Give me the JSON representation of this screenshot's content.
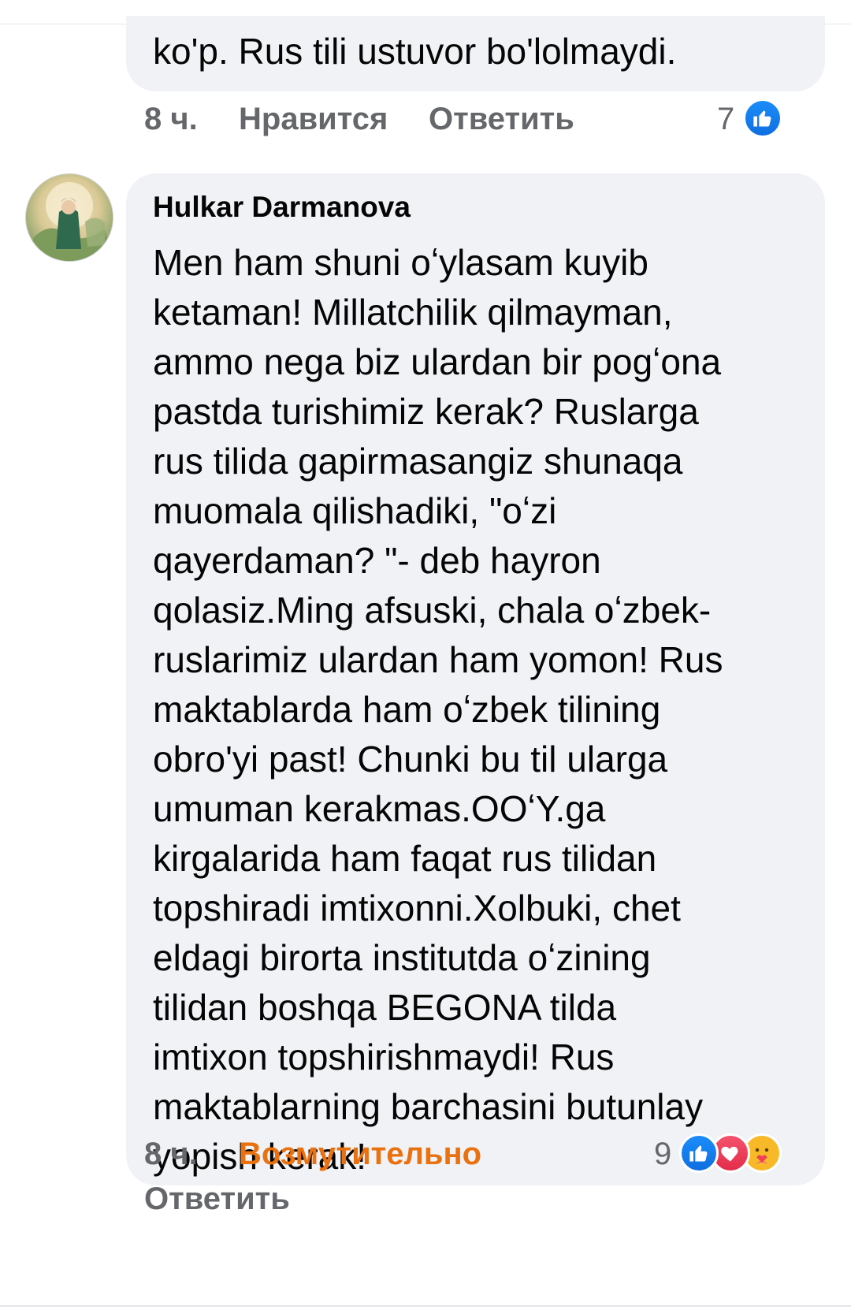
{
  "comment1": {
    "text_tail": "ko'p. Rus tili ustuvor bo'lolmaydi.",
    "time": "8 ч.",
    "like_label": "Нравится",
    "reply_label": "Ответить",
    "reaction_count": "7",
    "reaction_icons": [
      "like-icon"
    ]
  },
  "comment2": {
    "author": "Hulkar Darmanova",
    "lines": [
      "Men ham shuni oʻylasam kuyib",
      "ketaman!  Millatchilik qilmayman,",
      "ammo nega biz ulardan bir pogʻona",
      "pastda turishimiz kerak? Ruslarga",
      "rus tilida gapirmasangiz shunaqa",
      "muomala qilishadiki, \"oʻzi",
      "qayerdaman? \"- deb  hayron",
      "qolasiz.Ming afsuski, chala oʻzbek-",
      "ruslarimiz ulardan ham yomon! Rus",
      "maktablarda ham oʻzbek tilining",
      "obro'yi past! Chunki bu til ularga",
      "umuman kerakmas.OOʻY.ga",
      "kirgalarida ham faqat rus tilidan",
      "topshiradi imtixonni.Xolbuki, chet",
      "eldagi birorta institutda oʻzining",
      "tilidan boshqa BEGONA tilda",
      "imtixon topshirishmaydi! Rus",
      "maktablarning barchasini butunlay",
      "yopish kerak!"
    ],
    "time": "8 ч.",
    "reaction_label": "Возмутительно",
    "reaction_label_color": "#e9710f",
    "reply_label": "Ответить",
    "reaction_count": "9",
    "reaction_icons": [
      "like-icon",
      "love-icon",
      "care-icon"
    ]
  },
  "colors": {
    "bubble": "#f0f2f5",
    "meta_text": "#65676b",
    "like_blue": "#1877f2"
  }
}
